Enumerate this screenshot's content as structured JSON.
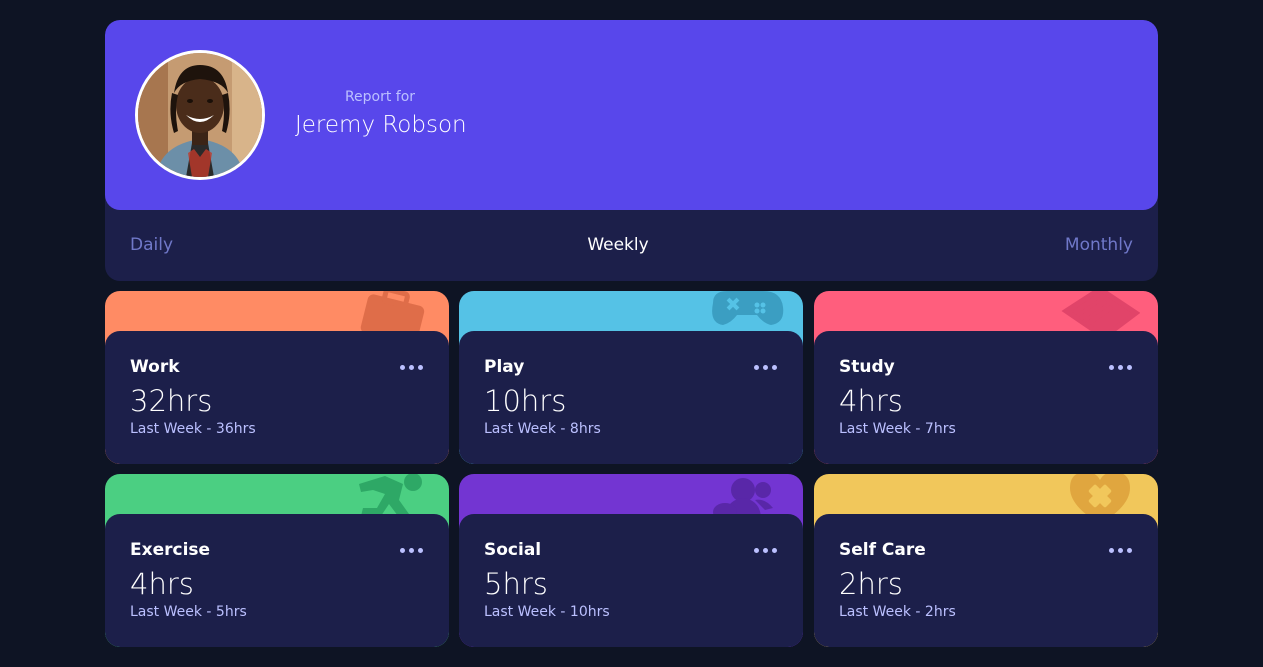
{
  "profile": {
    "report_label": "Report for",
    "name": "Jeremy Robson"
  },
  "tabs": [
    {
      "label": "Daily",
      "active": false
    },
    {
      "label": "Weekly",
      "active": true
    },
    {
      "label": "Monthly",
      "active": false
    }
  ],
  "cards": [
    {
      "title": "Work",
      "hours": "32hrs",
      "previous": "Last Week - 36hrs",
      "color": "#ff8b64",
      "icon": "briefcase-icon"
    },
    {
      "title": "Play",
      "hours": "10hrs",
      "previous": "Last Week - 8hrs",
      "color": "#55c2e6",
      "icon": "gamepad-icon"
    },
    {
      "title": "Study",
      "hours": "4hrs",
      "previous": "Last Week - 7hrs",
      "color": "#ff5e7d",
      "icon": "book-icon"
    },
    {
      "title": "Exercise",
      "hours": "4hrs",
      "previous": "Last Week - 5hrs",
      "color": "#4bcf82",
      "icon": "running-icon"
    },
    {
      "title": "Social",
      "hours": "5hrs",
      "previous": "Last Week - 10hrs",
      "color": "#7335d2",
      "icon": "social-icon"
    },
    {
      "title": "Self Care",
      "hours": "2hrs",
      "previous": "Last Week - 2hrs",
      "color": "#f1c75b",
      "icon": "heart-icon"
    }
  ],
  "colors": {
    "background": "#0e1424",
    "card_body": "#1c1f4a",
    "accent": "#5847eb",
    "muted_text": "#bbc0ff",
    "tab_inactive": "#7078c9"
  }
}
